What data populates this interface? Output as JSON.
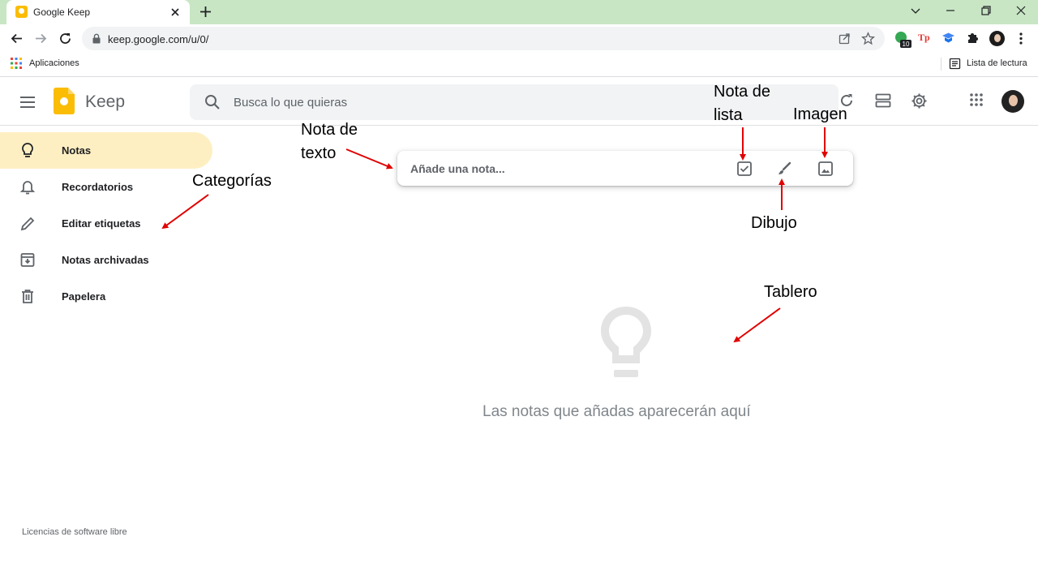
{
  "browser": {
    "tab_title": "Google Keep",
    "url": "keep.google.com/u/0/",
    "extension_badge": "10",
    "extension_tp": "Tp",
    "bookmarks_apps": "Aplicaciones",
    "reading_list": "Lista de lectura"
  },
  "keep": {
    "app_name": "Keep",
    "search_placeholder": "Busca lo que quieras",
    "sidebar": {
      "items": [
        {
          "label": "Notas",
          "icon": "lightbulb-icon",
          "active": true
        },
        {
          "label": "Recordatorios",
          "icon": "bell-icon",
          "active": false
        },
        {
          "label": "Editar etiquetas",
          "icon": "pencil-icon",
          "active": false
        },
        {
          "label": "Notas archivadas",
          "icon": "archive-icon",
          "active": false
        },
        {
          "label": "Papelera",
          "icon": "trash-icon",
          "active": false
        }
      ]
    },
    "take_note_placeholder": "Añade una nota...",
    "empty_message": "Las notas que añadas aparecerán aquí",
    "licenses": "Licencias de software libre",
    "accent_color": "#fbbc04",
    "active_item_bg": "#feefc3"
  },
  "annotations": {
    "text_note": [
      "Nota de",
      "texto"
    ],
    "list_note": [
      "Nota de",
      "lista"
    ],
    "image": "Imagen",
    "categories": "Categorías",
    "drawing": "Dibujo",
    "board": "Tablero",
    "arrow_color": "#e00000"
  }
}
